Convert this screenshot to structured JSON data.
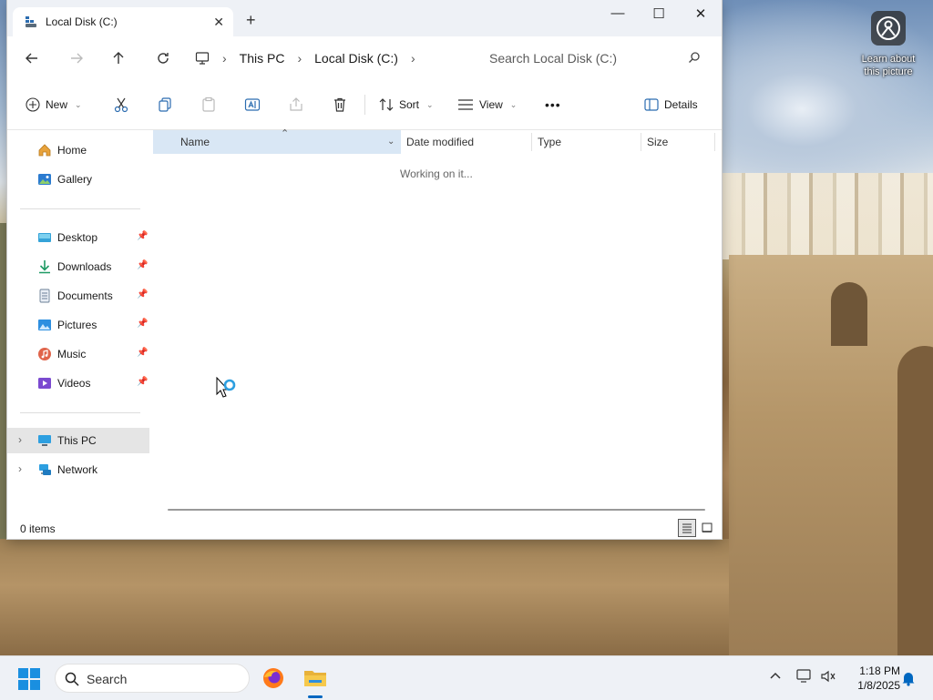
{
  "desktop": {
    "learn_label": "Learn about this picture"
  },
  "window": {
    "tab_title": "Local Disk (C:)",
    "breadcrumbs": [
      "This PC",
      "Local Disk (C:)"
    ],
    "search_placeholder": "Search Local Disk (C:)",
    "toolbar": {
      "new_label": "New",
      "sort_label": "Sort",
      "view_label": "View",
      "more_label": "•••",
      "details_label": "Details"
    },
    "sidebar": {
      "home": "Home",
      "gallery": "Gallery",
      "pinned": [
        {
          "label": "Desktop",
          "icon": "desktop-icon"
        },
        {
          "label": "Downloads",
          "icon": "download-icon"
        },
        {
          "label": "Documents",
          "icon": "document-icon"
        },
        {
          "label": "Pictures",
          "icon": "pictures-icon"
        },
        {
          "label": "Music",
          "icon": "music-icon"
        },
        {
          "label": "Videos",
          "icon": "video-icon"
        }
      ],
      "this_pc": "This PC",
      "network": "Network"
    },
    "columns": {
      "name": "Name",
      "date_modified": "Date modified",
      "type": "Type",
      "size": "Size"
    },
    "working_text": "Working on it...",
    "status_count": "0 items"
  },
  "taskbar": {
    "search_label": "Search",
    "time": "1:18 PM",
    "date": "1/8/2025"
  },
  "colors": {
    "accent": "#0067c0",
    "sorted_column": "#d9e7f5",
    "selected_nav": "#e5e5e5"
  }
}
